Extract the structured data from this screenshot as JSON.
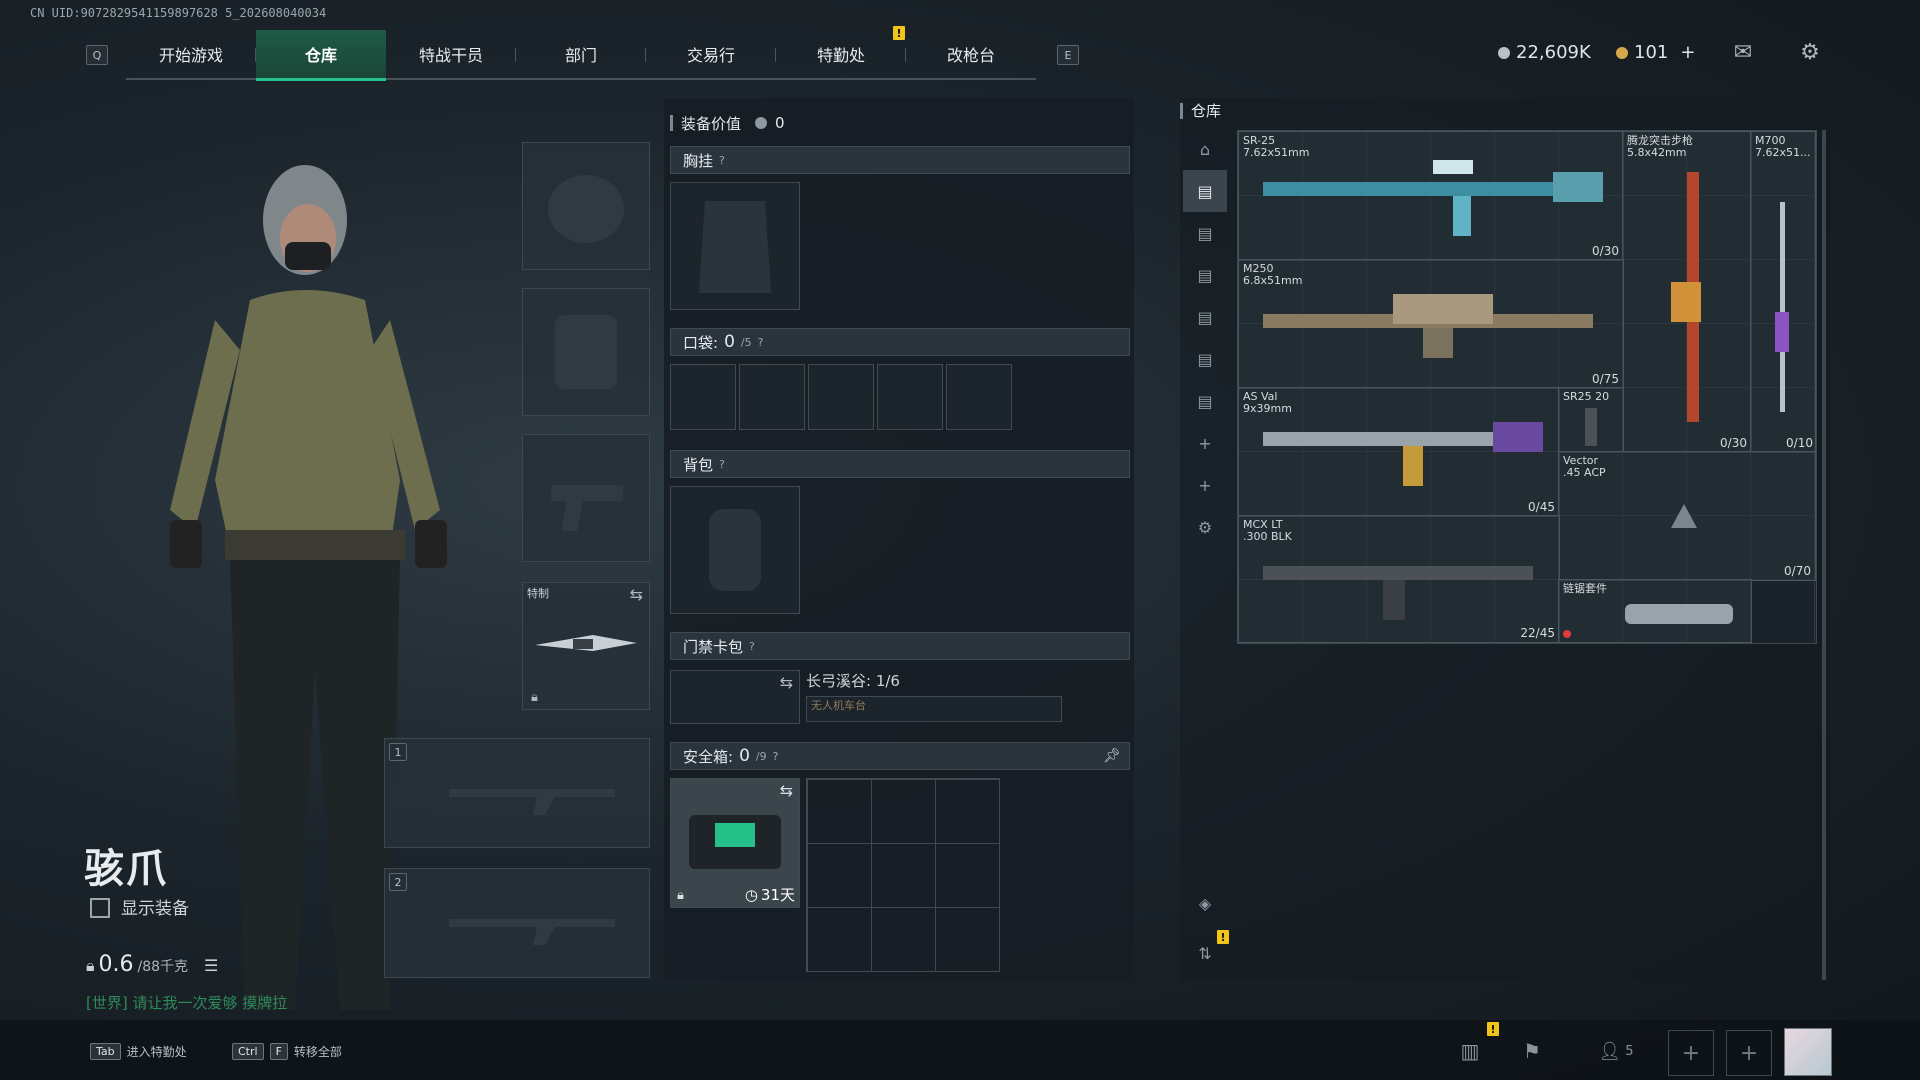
{
  "uid": "CN UID:9072829541159897628 5_202608040034",
  "nav": {
    "left_key": "Q",
    "right_key": "E",
    "tabs": [
      "开始游戏",
      "仓库",
      "特战干员",
      "部门",
      "交易行",
      "特勤处",
      "改枪台"
    ],
    "active_tab": "仓库"
  },
  "currency": {
    "silver": "22,609K",
    "gold": "101",
    "plus": "+"
  },
  "character": {
    "name": "骇爪",
    "show_gear_label": "显示装备",
    "weight_value": "0.6",
    "weight_max": "/88千克",
    "chat_channel": "[世界]",
    "chat_text": "请让我一次爱够 摸牌拉"
  },
  "slots": {
    "melee_label": "特制",
    "weapon1_num": "1",
    "weapon2_num": "2"
  },
  "middle": {
    "value_label": "装备价值",
    "value": "0",
    "chest_label": "胸挂",
    "pocket_label": "口袋:",
    "pocket_count": "0",
    "pocket_cap": "/5",
    "backpack_label": "背包",
    "keycard_label": "门禁卡包",
    "keycard_map": "长弓溪谷: 1/6",
    "keycard_item": "无人机车台",
    "safe_label": "安全箱:",
    "safe_count": "0",
    "safe_cap": "/9",
    "safe_days": "31天",
    "help": "?"
  },
  "warehouse": {
    "title": "仓库",
    "items": [
      {
        "name": "SR-25\n7.62x51mm",
        "ammo": "0/30"
      },
      {
        "name": "腾龙突击步枪\n5.8x42mm",
        "ammo": "0/30"
      },
      {
        "name": "M700\n7.62x51...",
        "ammo": "0/10"
      },
      {
        "name": "M250\n6.8x51mm",
        "ammo": "0/75"
      },
      {
        "name": "AS Val\n9x39mm",
        "ammo": "0/45"
      },
      {
        "name": "SR25 20",
        "ammo": ""
      },
      {
        "name": "Vector\n.45 ACP",
        "ammo": "0/70"
      },
      {
        "name": "MCX LT\n.300 BLK",
        "ammo": "22/45"
      },
      {
        "name": "链锯套件",
        "ammo": ""
      }
    ]
  },
  "bottom": {
    "tab_key": "Tab",
    "tab_label": "进入特勤处",
    "ctrl_key": "Ctrl",
    "f_key": "F",
    "transfer_label": "转移全部",
    "squad_count": "5"
  },
  "colors": {
    "accent": "#26c08a",
    "alert": "#f0c419",
    "chat": "#2f8a5c"
  }
}
